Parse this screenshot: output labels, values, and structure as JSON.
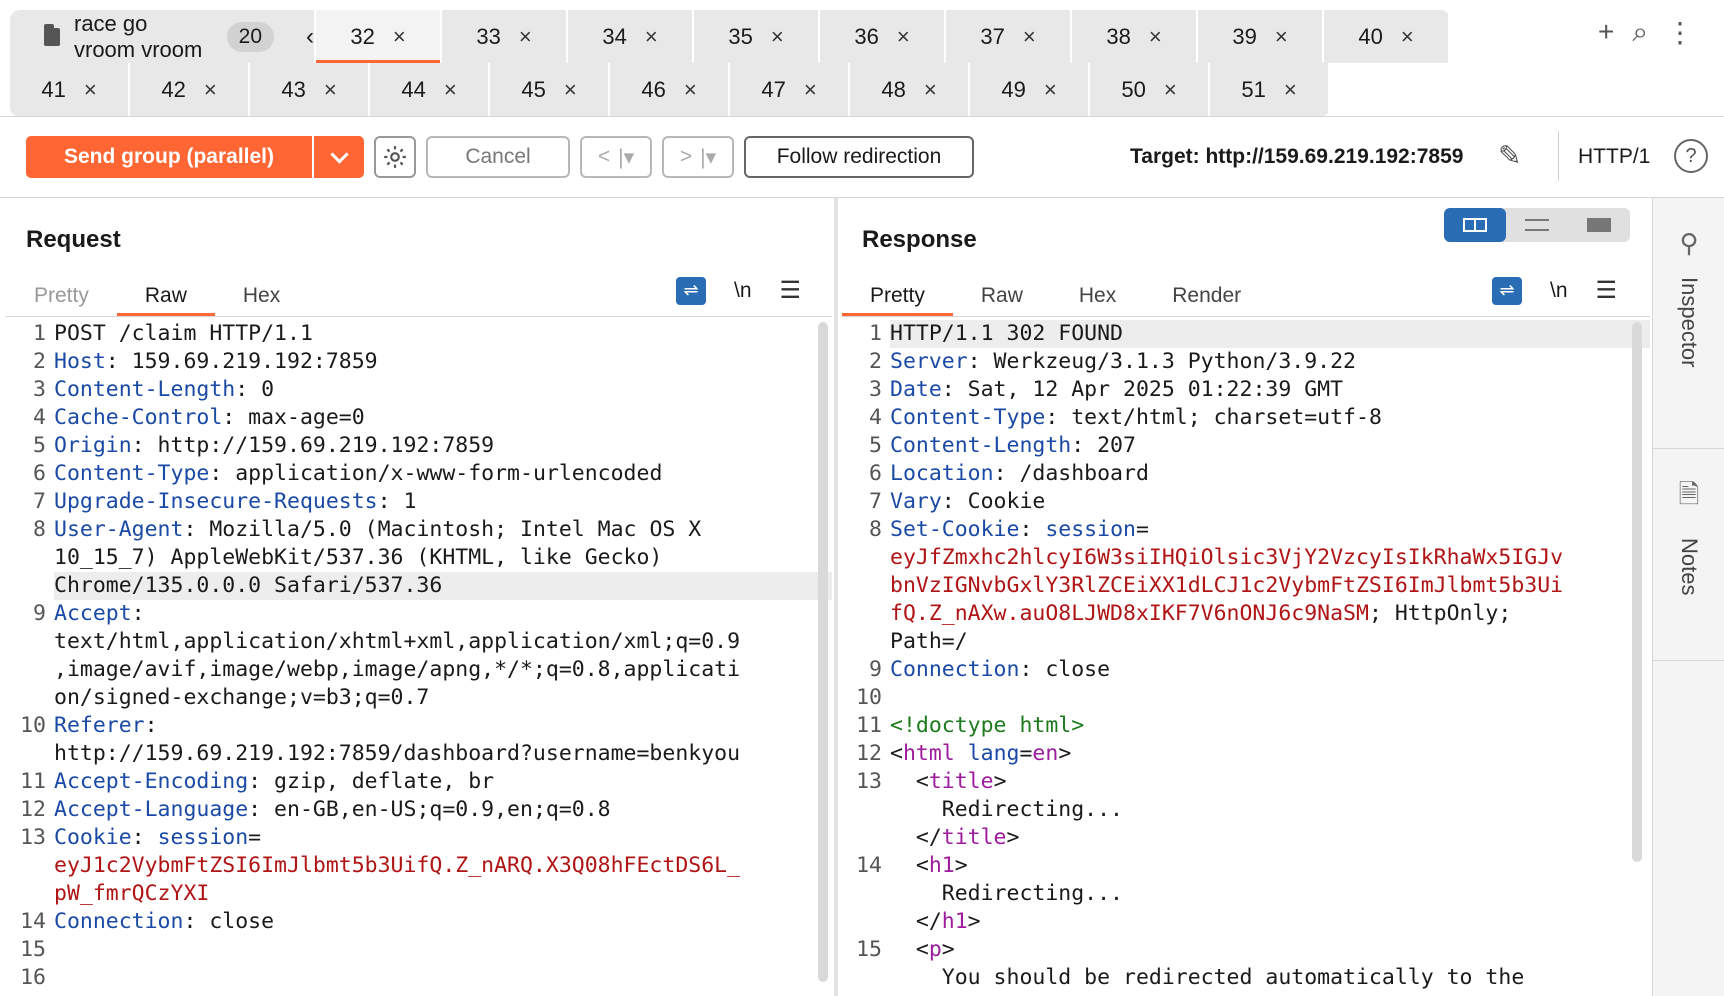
{
  "tabs": {
    "group": {
      "name": "race go vroom vroom",
      "count": "20"
    },
    "row1": [
      {
        "label": "32",
        "active": true
      },
      {
        "label": "33"
      },
      {
        "label": "34"
      },
      {
        "label": "35"
      },
      {
        "label": "36"
      },
      {
        "label": "37"
      },
      {
        "label": "38"
      },
      {
        "label": "39"
      },
      {
        "label": "40"
      }
    ],
    "row2": [
      {
        "label": "41"
      },
      {
        "label": "42"
      },
      {
        "label": "43"
      },
      {
        "label": "44"
      },
      {
        "label": "45"
      },
      {
        "label": "46"
      },
      {
        "label": "47"
      },
      {
        "label": "48"
      },
      {
        "label": "49"
      },
      {
        "label": "50"
      },
      {
        "label": "51"
      }
    ],
    "close_glyph": "×"
  },
  "toolbar": {
    "send_label": "Send group (parallel)",
    "cancel_label": "Cancel",
    "follow_label": "Follow redirection",
    "target": "Target: http://159.69.219.192:7859",
    "http_version": "HTTP/1"
  },
  "request": {
    "title": "Request",
    "tabs": [
      "Pretty",
      "Raw",
      "Hex"
    ],
    "lines": [
      {
        "n": "1",
        "parts": [
          {
            "t": "POST /claim HTTP/1.1",
            "c": "v"
          }
        ]
      },
      {
        "n": "2",
        "parts": [
          {
            "t": "Host",
            "c": "k"
          },
          {
            "t": ": 159.69.219.192:7859",
            "c": "v"
          }
        ]
      },
      {
        "n": "3",
        "parts": [
          {
            "t": "Content-Length",
            "c": "k"
          },
          {
            "t": ": 0",
            "c": "v"
          }
        ]
      },
      {
        "n": "4",
        "parts": [
          {
            "t": "Cache-Control",
            "c": "k"
          },
          {
            "t": ": max-age=0",
            "c": "v"
          }
        ]
      },
      {
        "n": "5",
        "parts": [
          {
            "t": "Origin",
            "c": "k"
          },
          {
            "t": ": http://159.69.219.192:7859",
            "c": "v"
          }
        ]
      },
      {
        "n": "6",
        "parts": [
          {
            "t": "Content-Type",
            "c": "k"
          },
          {
            "t": ": application/x-www-form-urlencoded",
            "c": "v"
          }
        ]
      },
      {
        "n": "7",
        "parts": [
          {
            "t": "Upgrade-Insecure-Requests",
            "c": "k"
          },
          {
            "t": ": 1",
            "c": "v"
          }
        ]
      },
      {
        "n": "8",
        "parts": [
          {
            "t": "User-Agent",
            "c": "k"
          },
          {
            "t": ": Mozilla/5.0 (Macintosh; Intel Mac OS X",
            "c": "v"
          }
        ]
      },
      {
        "n": "",
        "parts": [
          {
            "t": "10_15_7) AppleWebKit/537.36 (KHTML, like Gecko)",
            "c": "v"
          }
        ]
      },
      {
        "n": "",
        "hl": true,
        "parts": [
          {
            "t": "Chrome/135.0.0.0 Safari/537.36",
            "c": "v"
          }
        ]
      },
      {
        "n": "9",
        "parts": [
          {
            "t": "Accept",
            "c": "k"
          },
          {
            "t": ":",
            "c": "v"
          }
        ]
      },
      {
        "n": "",
        "parts": [
          {
            "t": "text/html,application/xhtml+xml,application/xml;q=0.9",
            "c": "v"
          }
        ]
      },
      {
        "n": "",
        "parts": [
          {
            "t": ",image/avif,image/webp,image/apng,*/*;q=0.8,applicati",
            "c": "v"
          }
        ]
      },
      {
        "n": "",
        "parts": [
          {
            "t": "on/signed-exchange;v=b3;q=0.7",
            "c": "v"
          }
        ]
      },
      {
        "n": "10",
        "parts": [
          {
            "t": "Referer",
            "c": "k"
          },
          {
            "t": ":",
            "c": "v"
          }
        ]
      },
      {
        "n": "",
        "parts": [
          {
            "t": "http://159.69.219.192:7859/dashboard?username=benkyou",
            "c": "v"
          }
        ]
      },
      {
        "n": "11",
        "parts": [
          {
            "t": "Accept-Encoding",
            "c": "k"
          },
          {
            "t": ": gzip, deflate, br",
            "c": "v"
          }
        ]
      },
      {
        "n": "12",
        "parts": [
          {
            "t": "Accept-Language",
            "c": "k"
          },
          {
            "t": ": en-GB,en-US;q=0.9,en;q=0.8",
            "c": "v"
          }
        ]
      },
      {
        "n": "13",
        "parts": [
          {
            "t": "Cookie",
            "c": "k"
          },
          {
            "t": ": ",
            "c": "v"
          },
          {
            "t": "session",
            "c": "k"
          },
          {
            "t": "=",
            "c": "v"
          }
        ]
      },
      {
        "n": "",
        "parts": [
          {
            "t": "eyJ1c2VybmFtZSI6ImJlbmt5b3UifQ.Z_nARQ.X3Q08hFEctDS6L_",
            "c": "r"
          }
        ]
      },
      {
        "n": "",
        "parts": [
          {
            "t": "pW_fmrQCzYXI",
            "c": "r"
          }
        ]
      },
      {
        "n": "14",
        "parts": [
          {
            "t": "Connection",
            "c": "k"
          },
          {
            "t": ": close",
            "c": "v"
          }
        ]
      },
      {
        "n": "15",
        "parts": [
          {
            "t": "",
            "c": "v"
          }
        ]
      },
      {
        "n": "16",
        "parts": [
          {
            "t": "",
            "c": "v"
          }
        ]
      }
    ]
  },
  "response": {
    "title": "Response",
    "tabs": [
      "Pretty",
      "Raw",
      "Hex",
      "Render"
    ],
    "lines": [
      {
        "n": "1",
        "hl": true,
        "parts": [
          {
            "t": "HTTP/1.1 302 FOUND",
            "c": "v"
          }
        ]
      },
      {
        "n": "2",
        "parts": [
          {
            "t": "Server",
            "c": "k"
          },
          {
            "t": ": Werkzeug/3.1.3 Python/3.9.22",
            "c": "v"
          }
        ]
      },
      {
        "n": "3",
        "parts": [
          {
            "t": "Date",
            "c": "k"
          },
          {
            "t": ": Sat, 12 Apr 2025 01:22:39 GMT",
            "c": "v"
          }
        ]
      },
      {
        "n": "4",
        "parts": [
          {
            "t": "Content-Type",
            "c": "k"
          },
          {
            "t": ": text/html; charset=utf-8",
            "c": "v"
          }
        ]
      },
      {
        "n": "5",
        "parts": [
          {
            "t": "Content-Length",
            "c": "k"
          },
          {
            "t": ": 207",
            "c": "v"
          }
        ]
      },
      {
        "n": "6",
        "parts": [
          {
            "t": "Location",
            "c": "k"
          },
          {
            "t": ": /dashboard",
            "c": "v"
          }
        ]
      },
      {
        "n": "7",
        "parts": [
          {
            "t": "Vary",
            "c": "k"
          },
          {
            "t": ": Cookie",
            "c": "v"
          }
        ]
      },
      {
        "n": "8",
        "parts": [
          {
            "t": "Set-Cookie",
            "c": "k"
          },
          {
            "t": ": ",
            "c": "v"
          },
          {
            "t": "session",
            "c": "k"
          },
          {
            "t": "=",
            "c": "v"
          }
        ]
      },
      {
        "n": "",
        "parts": [
          {
            "t": "eyJfZmxhc2hlcyI6W3siIHQiOlsic3VjY2VzcyIsIkRhaWx5IGJv",
            "c": "r"
          }
        ]
      },
      {
        "n": "",
        "parts": [
          {
            "t": "bnVzIGNvbGxlY3RlZCEiXX1dLCJ1c2VybmFtZSI6ImJlbmt5b3Ui",
            "c": "r"
          }
        ]
      },
      {
        "n": "",
        "parts": [
          {
            "t": "fQ.Z_nAXw.auO8LJWD8xIKF7V6nONJ6c9NaSM",
            "c": "r"
          },
          {
            "t": "; HttpOnly;",
            "c": "v"
          }
        ]
      },
      {
        "n": "",
        "parts": [
          {
            "t": "Path=/",
            "c": "v"
          }
        ]
      },
      {
        "n": "9",
        "parts": [
          {
            "t": "Connection",
            "c": "k"
          },
          {
            "t": ": close",
            "c": "v"
          }
        ]
      },
      {
        "n": "10",
        "parts": [
          {
            "t": "",
            "c": "v"
          }
        ]
      },
      {
        "n": "11",
        "parts": [
          {
            "t": "<!doctype html>",
            "c": "g"
          }
        ]
      },
      {
        "n": "12",
        "parts": [
          {
            "t": "<",
            "c": "v"
          },
          {
            "t": "html",
            "c": "tag"
          },
          {
            "t": " ",
            "c": "v"
          },
          {
            "t": "lang",
            "c": "k"
          },
          {
            "t": "=",
            "c": "v"
          },
          {
            "t": "en",
            "c": "tag"
          },
          {
            "t": ">",
            "c": "v"
          }
        ]
      },
      {
        "n": "13",
        "parts": [
          {
            "t": "  <",
            "c": "v"
          },
          {
            "t": "title",
            "c": "tag"
          },
          {
            "t": ">",
            "c": "v"
          }
        ]
      },
      {
        "n": "",
        "parts": [
          {
            "t": "    Redirecting...",
            "c": "v"
          }
        ]
      },
      {
        "n": "",
        "parts": [
          {
            "t": "  </",
            "c": "v"
          },
          {
            "t": "title",
            "c": "tag"
          },
          {
            "t": ">",
            "c": "v"
          }
        ]
      },
      {
        "n": "14",
        "parts": [
          {
            "t": "  <",
            "c": "v"
          },
          {
            "t": "h1",
            "c": "tag"
          },
          {
            "t": ">",
            "c": "v"
          }
        ]
      },
      {
        "n": "",
        "parts": [
          {
            "t": "    Redirecting...",
            "c": "v"
          }
        ]
      },
      {
        "n": "",
        "parts": [
          {
            "t": "  </",
            "c": "v"
          },
          {
            "t": "h1",
            "c": "tag"
          },
          {
            "t": ">",
            "c": "v"
          }
        ]
      },
      {
        "n": "15",
        "parts": [
          {
            "t": "  <",
            "c": "v"
          },
          {
            "t": "p",
            "c": "tag"
          },
          {
            "t": ">",
            "c": "v"
          }
        ]
      },
      {
        "n": "",
        "parts": [
          {
            "t": "    You should be redirected automatically to the",
            "c": "v"
          }
        ]
      }
    ]
  },
  "sidebar": {
    "items": [
      {
        "label": "Inspector",
        "icon": "inspector-icon"
      },
      {
        "label": "Notes",
        "icon": "notes-icon"
      }
    ]
  },
  "colors": {
    "accent": "#ff6633",
    "header_key": "#1a4aa6",
    "cookie_value": "#b01414",
    "toggle_active": "#2a6db5"
  }
}
